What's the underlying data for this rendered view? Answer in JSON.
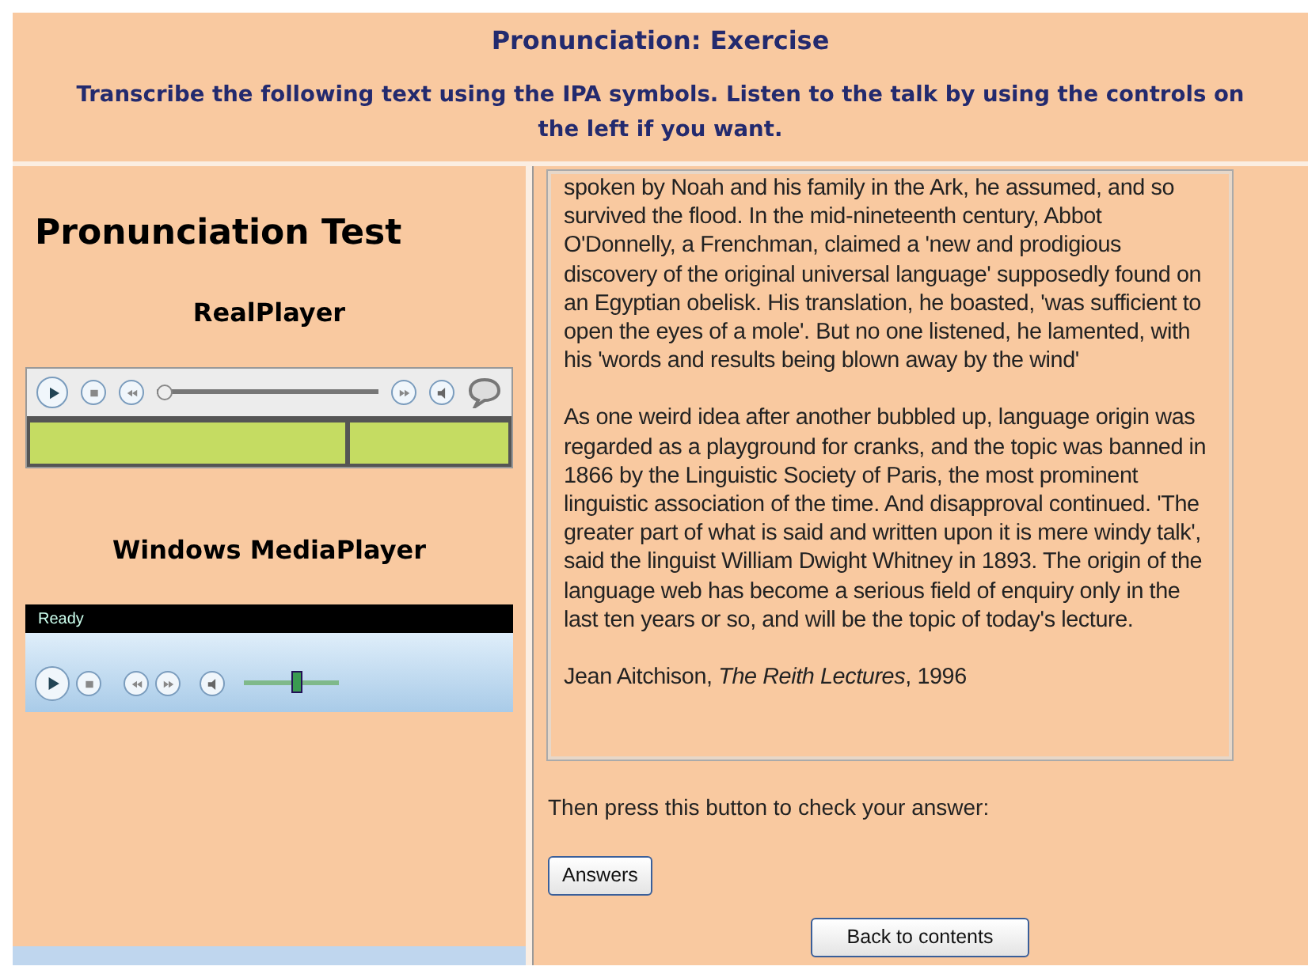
{
  "header": {
    "title": "Pronunciation: Exercise",
    "instructions": "Transcribe the following text using the IPA symbols. Listen to the talk by using the controls on the left if you want."
  },
  "sidebar": {
    "title": "Pronunciation Test",
    "players": [
      {
        "kind": "realplayer",
        "heading": "RealPlayer",
        "position": {
          "level": 0
        }
      },
      {
        "kind": "mediaplayer",
        "heading": "Windows MediaPlayer",
        "status": "Ready",
        "volume": {
          "level": 0.55
        }
      }
    ]
  },
  "passage": [
    "spoken by Noah and his family in the Ark, he assumed, and so survived the flood. In the mid-nineteenth century, Abbot O'Donnelly, a Frenchman, claimed a 'new and prodigious discovery of the original universal language' supposedly found on an Egyptian obelisk. His translation, he boasted, 'was sufficient to open the eyes of a mole'. But no one listened, he lamented, with his 'words and results being blown away by the wind'",
    "As one weird idea after another bubbled up, language origin was regarded as a playground for cranks, and the topic was banned in 1866 by the Linguistic Society of Paris, the most prominent linguistic association of the time. And disapproval continued. 'The greater part of what is said and written upon it is mere windy talk', said the linguist William Dwight Whitney in 1893. The origin of the language web has become a serious field of enquiry only in the last ten years or so, and will be the topic of today's lecture.",
    "Jean Aitchison, *The Reith Lectures*, 1996"
  ],
  "prompt": "Then press this button to check your answer:",
  "answers_button": "Answers",
  "back_button": "Back to contents"
}
